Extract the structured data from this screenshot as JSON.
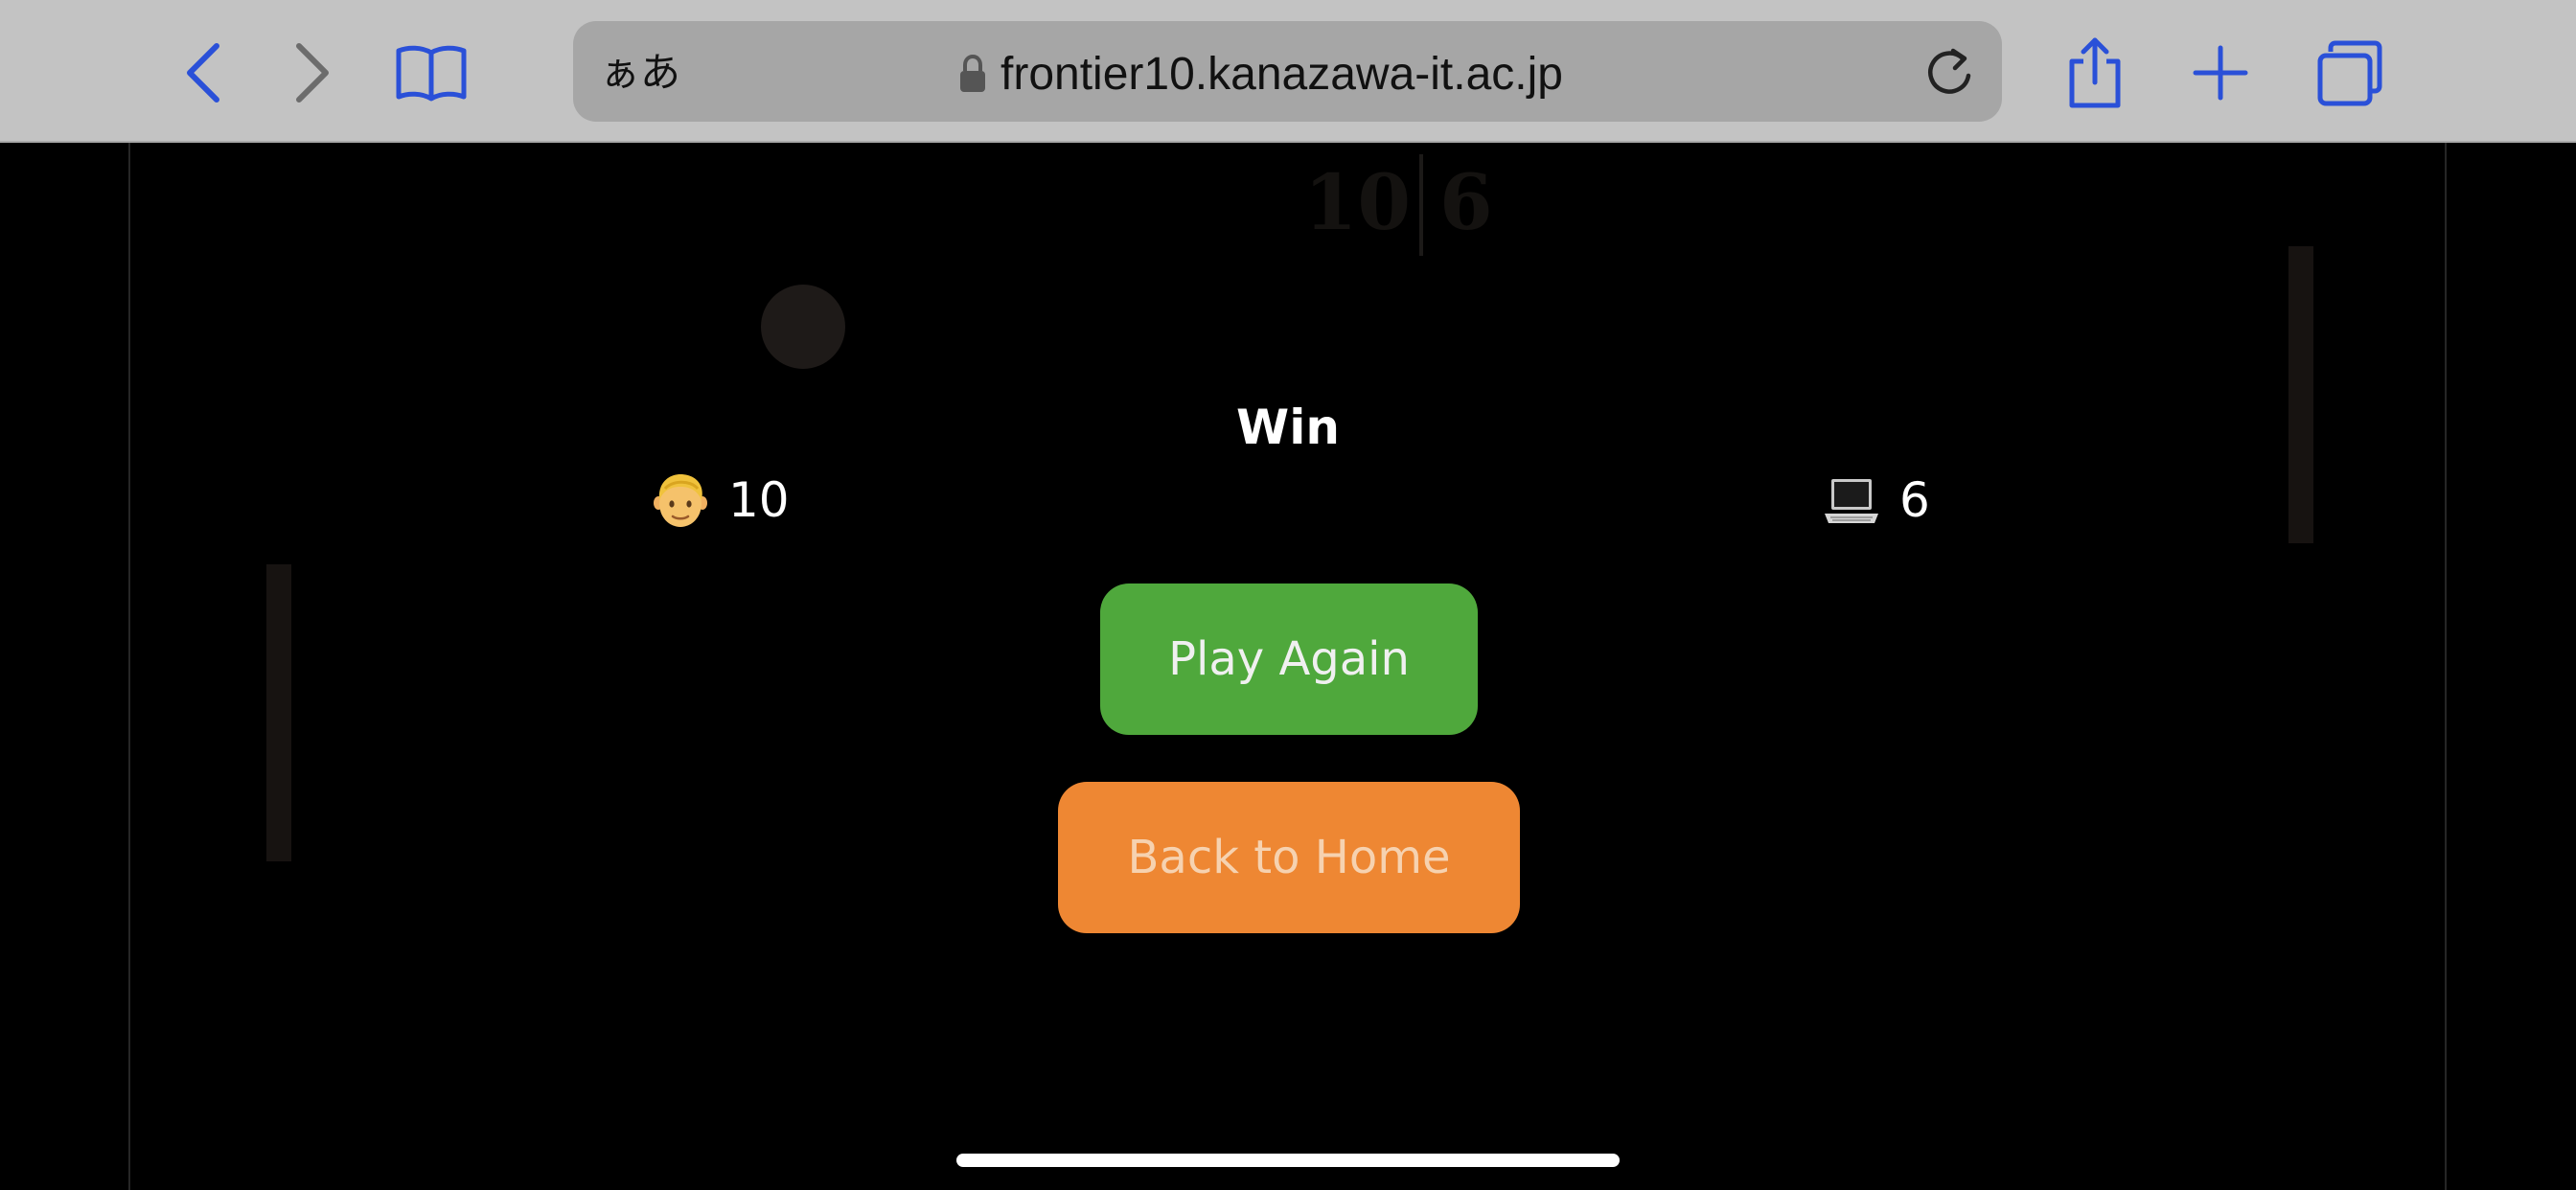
{
  "browser": {
    "reader_label": "ぁあ",
    "url": "frontier10.kanazawa-it.ac.jp",
    "accent_color": "#2a50d8",
    "icons": {
      "back": "chevron-left-icon",
      "forward": "chevron-right-icon",
      "bookmarks": "open-book-icon",
      "lock": "lock-icon",
      "reload": "reload-icon",
      "share": "share-icon",
      "new_tab": "plus-icon",
      "tabs": "tabs-icon"
    }
  },
  "game": {
    "scoreboard": {
      "left": "10",
      "right": "6"
    },
    "result_title": "Win",
    "player": {
      "icon": "man-face-emoji-icon",
      "score": "10"
    },
    "cpu": {
      "icon": "laptop-emoji-icon",
      "score": "6"
    },
    "buttons": {
      "play_again": "Play Again",
      "back_home": "Back to Home"
    },
    "colors": {
      "play_again": "#4fa83c",
      "back_home": "#ee8733"
    }
  }
}
